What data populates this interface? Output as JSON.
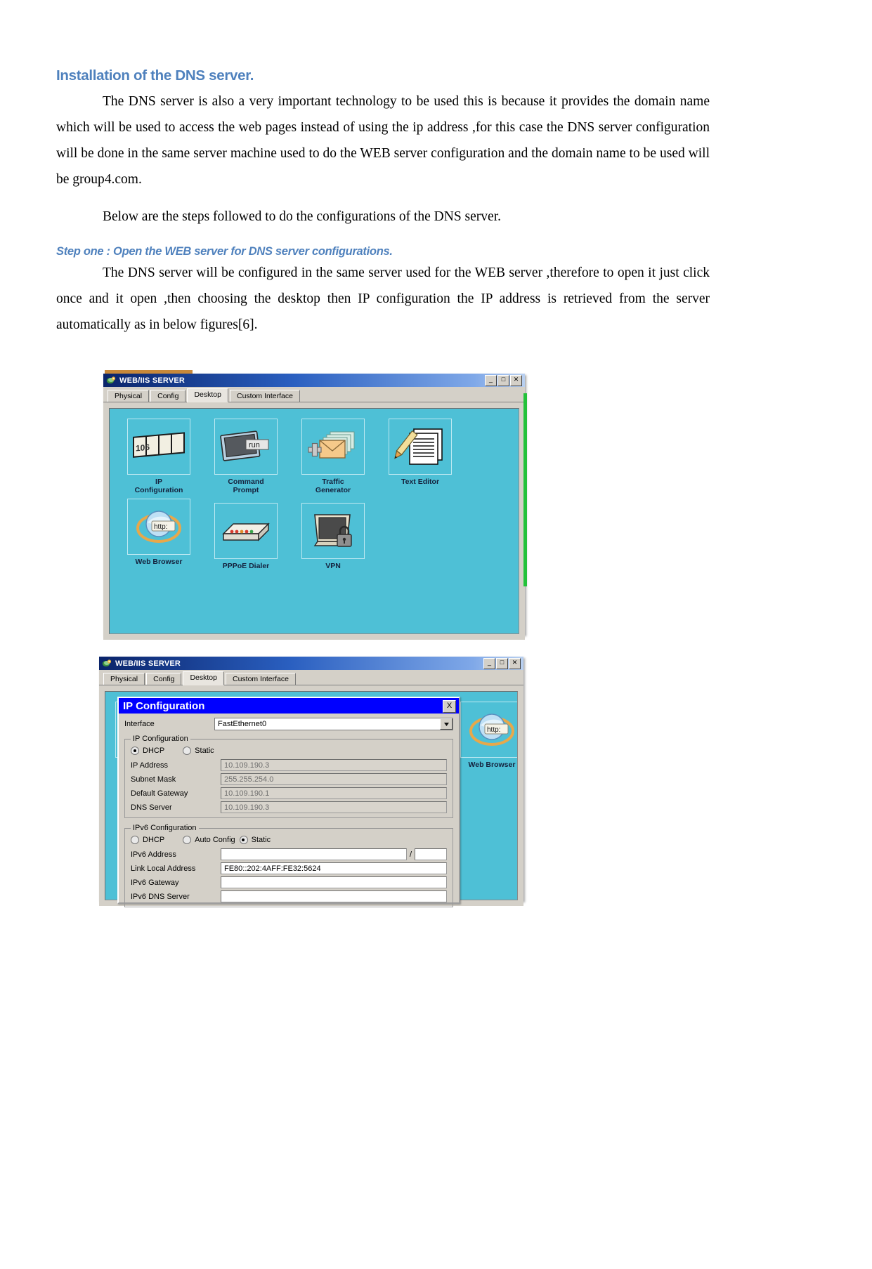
{
  "document": {
    "heading": "Installation of the DNS server.",
    "paragraph_1": "The DNS server is also a very important  technology to be used this is because it provides the domain name which will be used to access the web pages instead of using the ip address ,for this case the DNS server configuration will be done in the same server machine used to do the WEB server configuration  and the domain name to be used will be group4.com.",
    "paragraph_2": "Below are the steps followed to do the configurations of the DNS server.",
    "sub_heading": "Step one : Open the WEB server for DNS server configurations.",
    "paragraph_3": "The DNS server will be configured in the same server used for the WEB server  ,therefore to open it just click once and it open ,then choosing the desktop then IP configuration the IP address is retrieved from the server automatically as in below figures[6].",
    "heading_color": "#4f81bd"
  },
  "figure_1": {
    "window": {
      "title": "WEB/IIS SERVER",
      "title_icon": "packet-tracer-icon",
      "minimize_label": "_",
      "maximize_label": "□",
      "close_label": "✕",
      "tabs": [
        {
          "label": "Physical",
          "active": false
        },
        {
          "label": "Config",
          "active": false
        },
        {
          "label": "Desktop",
          "active": true
        },
        {
          "label": "Custom Interface",
          "active": false
        }
      ],
      "desktop_bg": "#4ec0d6",
      "icons": [
        {
          "label": "IP\nConfiguration",
          "icon": "ip-configuration-icon",
          "badge": "106"
        },
        {
          "label": "Command\nPrompt",
          "icon": "command-prompt-icon",
          "badge": "run"
        },
        {
          "label": "Traffic\nGenerator",
          "icon": "traffic-generator-icon",
          "badge": ""
        },
        {
          "label": "Text Editor",
          "icon": "text-editor-icon",
          "badge": ""
        },
        {
          "label": "Web Browser",
          "icon": "web-browser-icon",
          "badge": "http:"
        },
        {
          "label": "PPPoE Dialer",
          "icon": "pppoe-dialer-icon",
          "badge": ""
        },
        {
          "label": "VPN",
          "icon": "vpn-icon",
          "badge": ""
        }
      ]
    }
  },
  "figure_2": {
    "window": {
      "title": "WEB/IIS SERVER",
      "title_icon": "packet-tracer-icon",
      "minimize_label": "_",
      "maximize_label": "□",
      "close_label": "✕",
      "tabs": [
        {
          "label": "Physical",
          "active": false
        },
        {
          "label": "Config",
          "active": false
        },
        {
          "label": "Desktop",
          "active": true
        },
        {
          "label": "Custom Interface",
          "active": false
        }
      ],
      "desktop_bg": "#4ec0d6",
      "background_icon_label": "Web Browser"
    },
    "dialog": {
      "title": "IP Configuration",
      "close_label": "X",
      "interface_label": "Interface",
      "interface_value": "FastEthernet0",
      "ipv4": {
        "group_label": "IP Configuration",
        "mode_dhcp": "DHCP",
        "mode_static": "Static",
        "selected_mode": "DHCP",
        "fields": [
          {
            "label": "IP Address",
            "value": "10.109.190.3"
          },
          {
            "label": "Subnet Mask",
            "value": "255.255.254.0"
          },
          {
            "label": "Default Gateway",
            "value": "10.109.190.1"
          },
          {
            "label": "DNS Server",
            "value": "10.109.190.3"
          }
        ]
      },
      "ipv6": {
        "group_label": "IPv6 Configuration",
        "mode_dhcp": "DHCP",
        "mode_auto": "Auto Config",
        "mode_static": "Static",
        "selected_mode": "Static",
        "fields": [
          {
            "label": "IPv6 Address",
            "value": "",
            "has_prefix": true,
            "prefix_value": ""
          },
          {
            "label": "Link Local Address",
            "value": "FE80::202:4AFF:FE32:5624",
            "has_prefix": false,
            "prefix_value": ""
          },
          {
            "label": "IPv6 Gateway",
            "value": "",
            "has_prefix": false,
            "prefix_value": ""
          },
          {
            "label": "IPv6 DNS Server",
            "value": "",
            "has_prefix": false,
            "prefix_value": ""
          }
        ]
      }
    }
  }
}
